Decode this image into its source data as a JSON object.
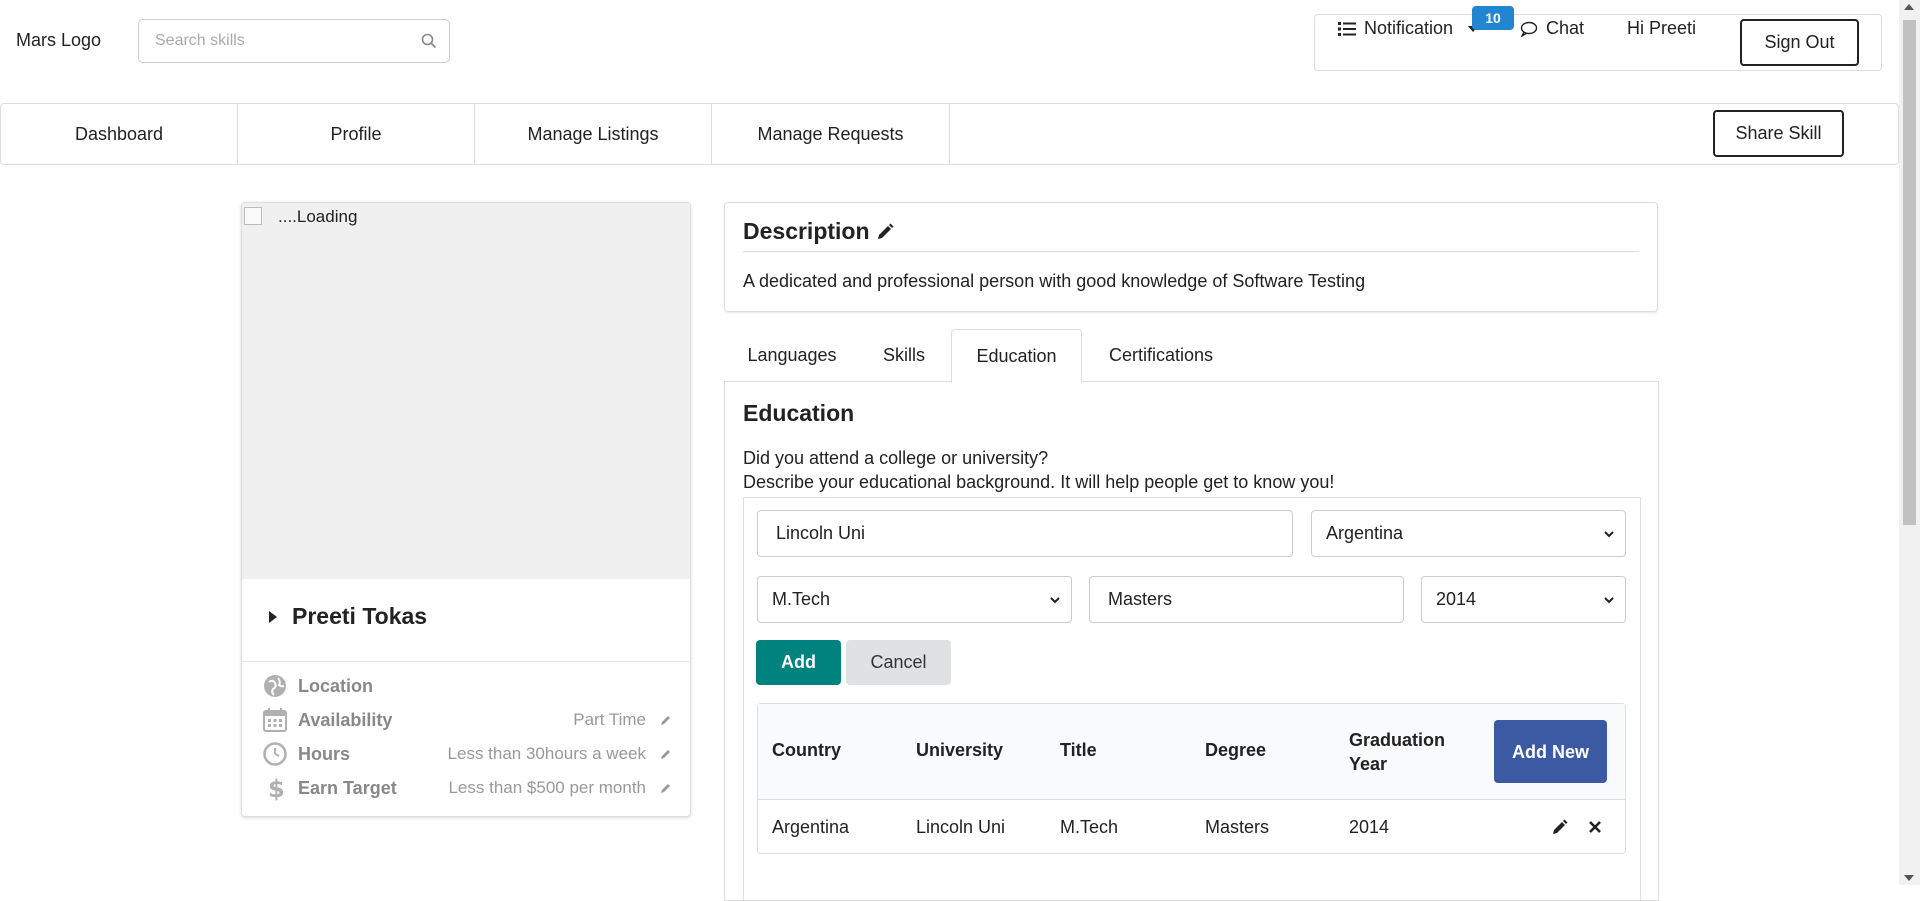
{
  "header": {
    "logo": "Mars Logo",
    "search_placeholder": "Search skills",
    "notification_label": "Notification",
    "notification_count": "10",
    "chat_label": "Chat",
    "greeting": "Hi Preeti",
    "signout_label": "Sign Out"
  },
  "nav": {
    "items": [
      "Dashboard",
      "Profile",
      "Manage Listings",
      "Manage Requests"
    ],
    "share_label": "Share Skill"
  },
  "profile": {
    "image_alt": "....Loading",
    "name": "Preeti Tokas",
    "location_label": "Location",
    "availability_label": "Availability",
    "availability_value": "Part Time",
    "hours_label": "Hours",
    "hours_value": "Less than 30hours a week",
    "earn_label": "Earn Target",
    "earn_value": "Less than $500 per month"
  },
  "description": {
    "title": "Description",
    "text": "A dedicated and professional person with good knowledge of Software Testing"
  },
  "tabs": [
    "Languages",
    "Skills",
    "Education",
    "Certifications"
  ],
  "active_tab": "Education",
  "education": {
    "title": "Education",
    "line1": "Did you attend a college or university?",
    "line2": "Describe your educational background. It will help people get to know you!",
    "form": {
      "university": "Lincoln Uni",
      "country": "Argentina",
      "title": "M.Tech",
      "degree": "Masters",
      "year": "2014",
      "add_label": "Add",
      "cancel_label": "Cancel"
    },
    "table": {
      "headers": [
        "Country",
        "University",
        "Title",
        "Degree",
        "Graduation Year"
      ],
      "add_new_label": "Add New",
      "rows": [
        [
          "Argentina",
          "Lincoln Uni",
          "M.Tech",
          "Masters",
          "2014"
        ]
      ]
    }
  },
  "colors": {
    "accent_teal": "#00827f",
    "accent_blue": "#3b5aa3",
    "badge_blue": "#2185d0"
  }
}
